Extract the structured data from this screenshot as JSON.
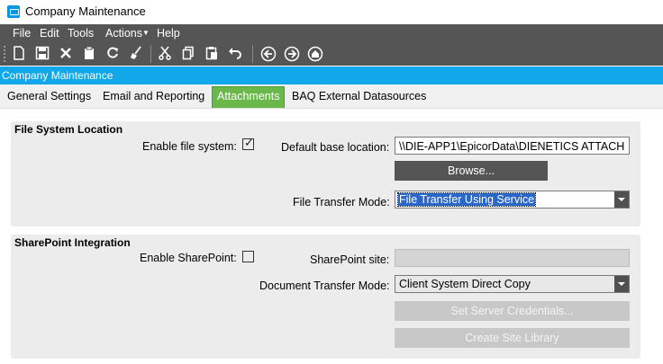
{
  "window": {
    "title": "Company Maintenance"
  },
  "menu": {
    "items": [
      "File",
      "Edit",
      "Tools",
      "Actions",
      "Help"
    ]
  },
  "toolbar": {
    "icons": [
      "new-icon",
      "save-icon",
      "delete-icon",
      "clipboard-icon",
      "refresh-icon",
      "clear-icon",
      "cut-icon",
      "copy-icon",
      "paste-icon",
      "undo-icon",
      "back-icon",
      "forward-icon",
      "home-icon"
    ]
  },
  "form": {
    "header": "Company Maintenance"
  },
  "tabs": [
    {
      "label": "General Settings",
      "active": false
    },
    {
      "label": "Email and Reporting",
      "active": false
    },
    {
      "label": "Attachments",
      "active": true
    },
    {
      "label": "BAQ External Datasources",
      "active": false
    }
  ],
  "file_system": {
    "title": "File System Location",
    "enable_label": "Enable file system:",
    "enable_checked": true,
    "base_location_label": "Default base location:",
    "base_location_value": "\\\\DIE-APP1\\EpicorData\\DIENETICS ATTACH",
    "browse_label": "Browse...",
    "transfer_mode_label": "File Transfer Mode:",
    "transfer_mode_value": "File Transfer Using Service"
  },
  "sharepoint": {
    "title": "SharePoint Integration",
    "enable_label": "Enable SharePoint:",
    "enable_checked": false,
    "site_label": "SharePoint site:",
    "site_value": "",
    "doc_mode_label": "Document Transfer Mode:",
    "doc_mode_value": "Client System Direct Copy",
    "credentials_label": "Set  Server Credentials...",
    "library_label": "Create Site Library"
  },
  "colors": {
    "menubar": "#555555",
    "form_header": "#12a7e8",
    "active_tab": "#6ab84a",
    "group_bg": "#ececec"
  }
}
